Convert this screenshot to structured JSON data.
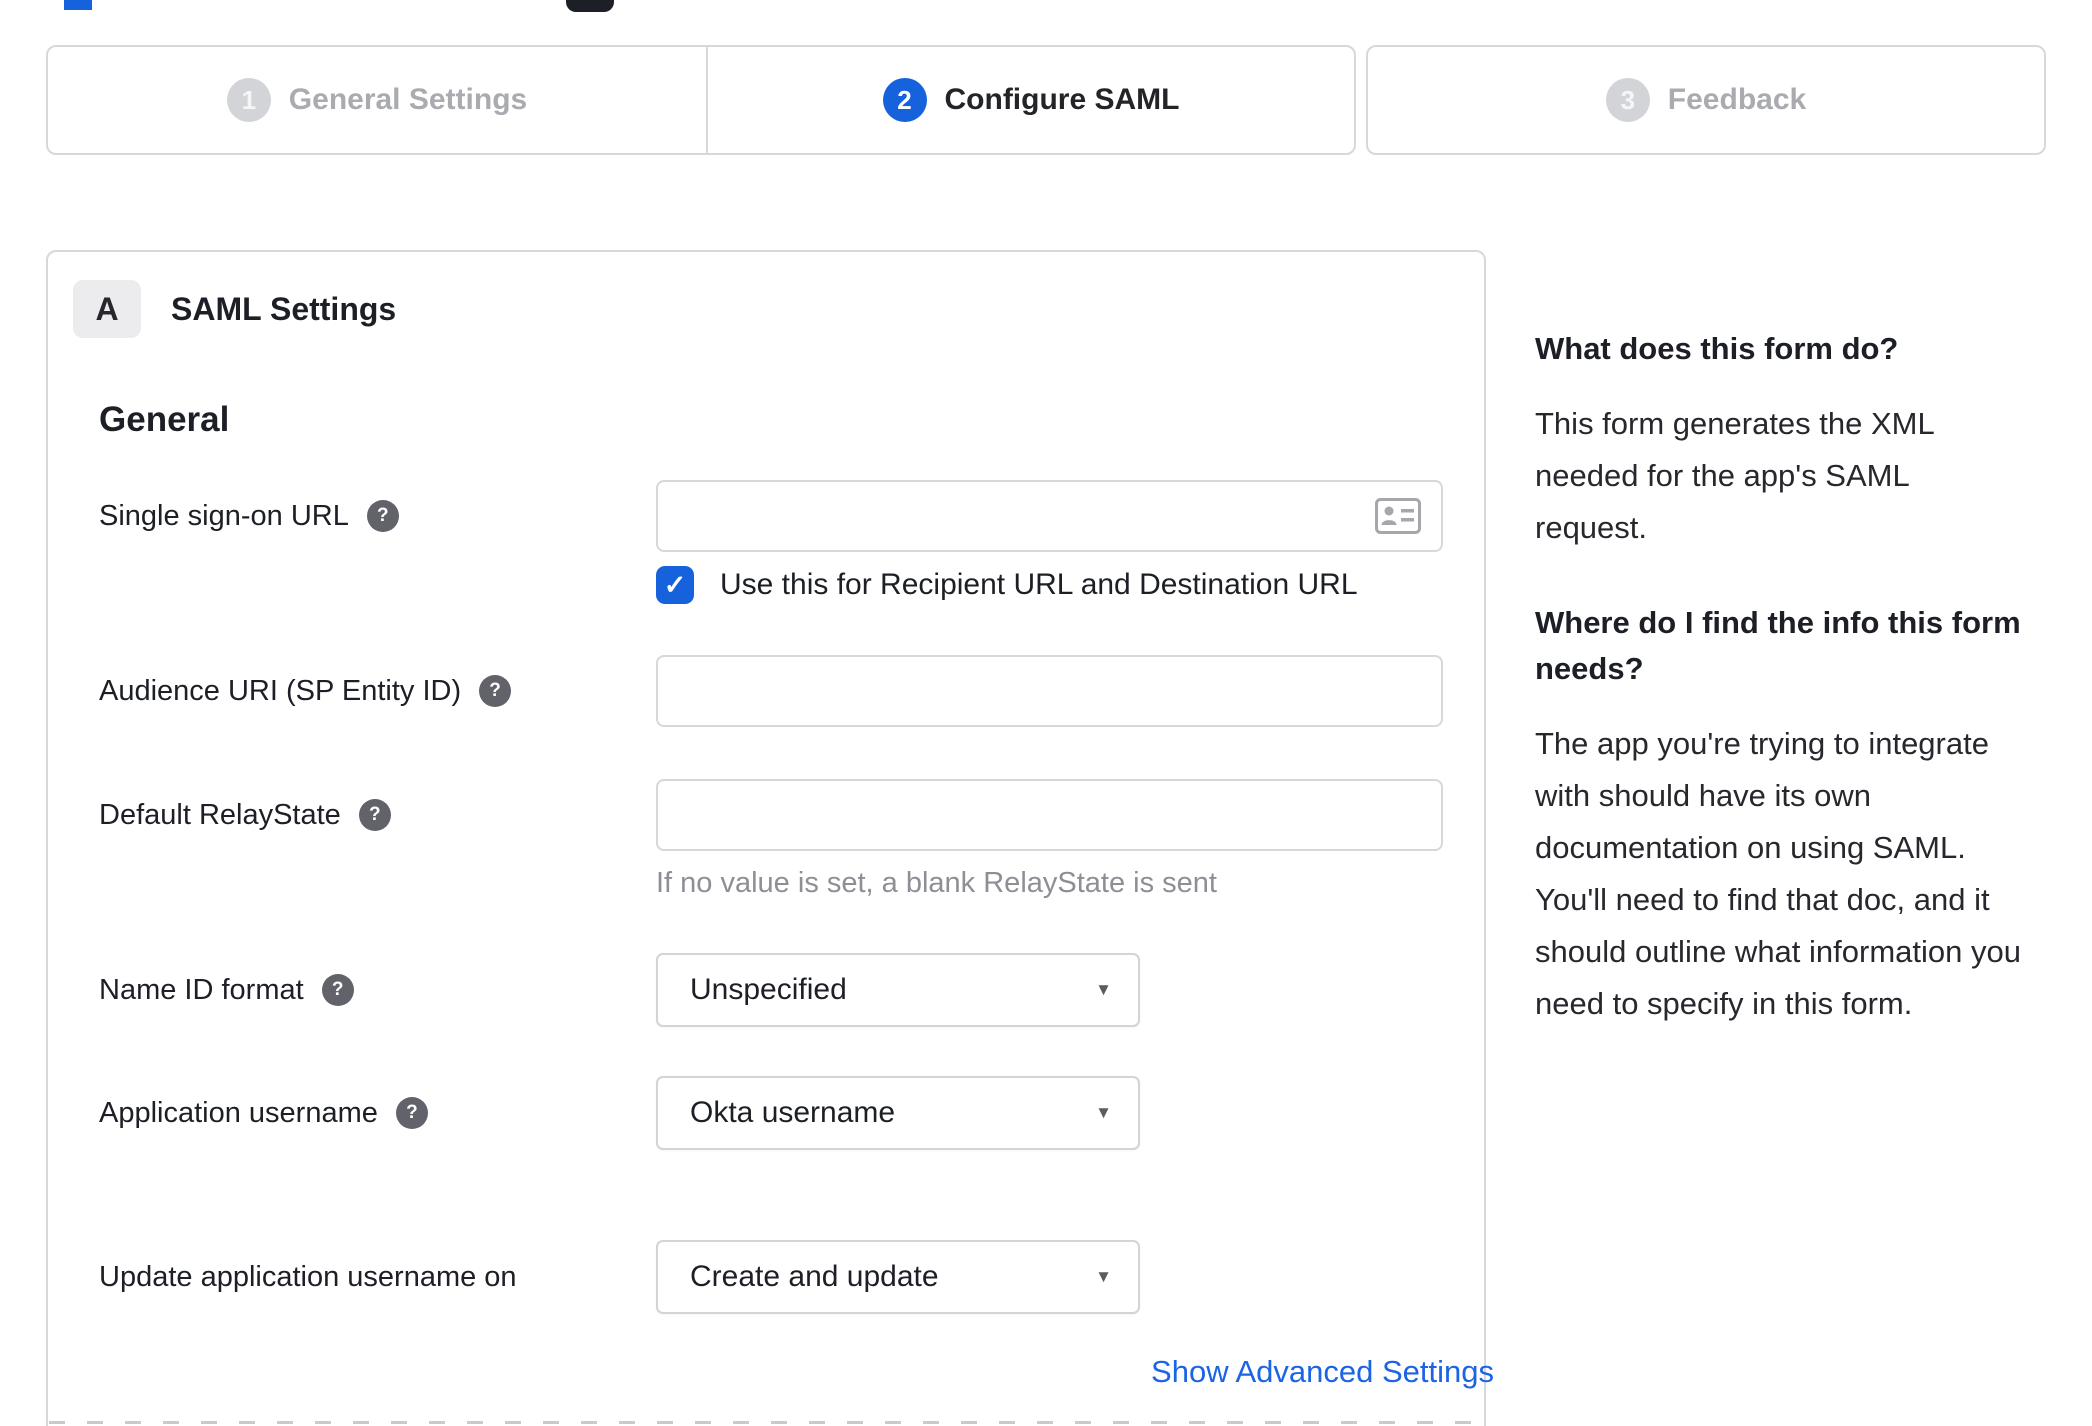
{
  "colors": {
    "accent": "#1662dd",
    "border": "#d7d7dc",
    "inactive_step": "#d3d4d8",
    "link": "#1b64e4",
    "helper_text": "#8e8e96"
  },
  "icons": {
    "help": "?",
    "check": "✓",
    "caret": "▼"
  },
  "stepper": {
    "steps": [
      {
        "number": "1",
        "label": "General Settings",
        "state": "inactive"
      },
      {
        "number": "2",
        "label": "Configure SAML",
        "state": "active"
      },
      {
        "number": "3",
        "label": "Feedback",
        "state": "inactive"
      }
    ]
  },
  "panel": {
    "badge": "A",
    "title": "SAML Settings",
    "section_heading": "General",
    "fields": [
      {
        "label": "Single sign-on URL",
        "type": "text",
        "value": "",
        "checkbox": {
          "checked": true,
          "label": "Use this for Recipient URL and Destination URL"
        }
      },
      {
        "label": "Audience URI (SP Entity ID)",
        "type": "text",
        "value": ""
      },
      {
        "label": "Default RelayState",
        "type": "text",
        "value": "",
        "helper": "If no value is set, a blank RelayState is sent"
      },
      {
        "label": "Name ID format",
        "type": "select",
        "value": "Unspecified"
      },
      {
        "label": "Application username",
        "type": "select",
        "value": "Okta username"
      },
      {
        "label": "Update application username on",
        "type": "select",
        "value": "Create and update"
      }
    ],
    "advanced_link": "Show Advanced Settings"
  },
  "sidebar": {
    "sections": [
      {
        "heading": "What does this form do?",
        "body": "This form generates the XML needed for the app's SAML request."
      },
      {
        "heading": "Where do I find the info this form needs?",
        "body": "The app you're trying to integrate with should have its own documentation on using SAML. You'll need to find that doc, and it should outline what information you need to specify in this form."
      }
    ]
  }
}
